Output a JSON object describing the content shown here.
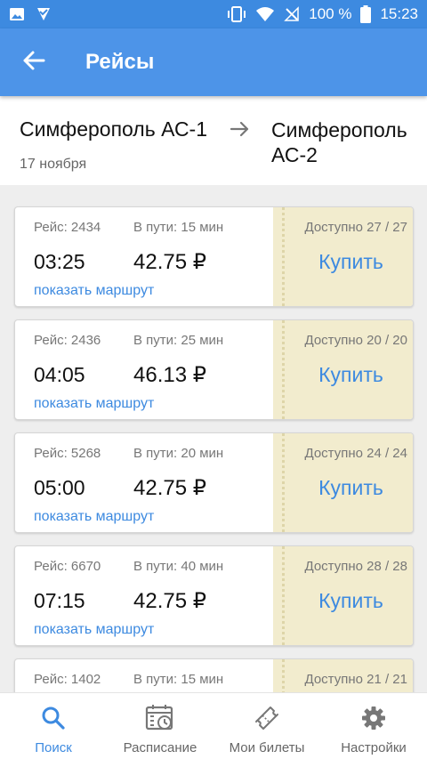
{
  "status_bar": {
    "battery": "100 %",
    "time": "15:23",
    "icons_left": [
      "image-icon",
      "notification-check-icon"
    ],
    "icons_right": [
      "vibrate-icon",
      "wifi-icon",
      "no-signal-icon",
      "battery-icon"
    ]
  },
  "app_bar": {
    "title": "Рейсы",
    "back_icon": "arrow-back-icon"
  },
  "route": {
    "from": "Симферополь АС-1",
    "to": "Симферополь АС-2",
    "date": "17 ноября"
  },
  "trips": [
    {
      "number": "Рейс: 2434",
      "duration": "В пути: 15 мин",
      "time": "03:25",
      "price": "42.75 ₽",
      "route_link": "показать маршрут",
      "availability": "Доступно 27 / 27",
      "buy_label": "Купить"
    },
    {
      "number": "Рейс: 2436",
      "duration": "В пути: 25 мин",
      "time": "04:05",
      "price": "46.13 ₽",
      "route_link": "показать маршрут",
      "availability": "Доступно 20 / 20",
      "buy_label": "Купить"
    },
    {
      "number": "Рейс: 5268",
      "duration": "В пути: 20 мин",
      "time": "05:00",
      "price": "42.75 ₽",
      "route_link": "показать маршрут",
      "availability": "Доступно 24 / 24",
      "buy_label": "Купить"
    },
    {
      "number": "Рейс: 6670",
      "duration": "В пути: 40 мин",
      "time": "07:15",
      "price": "42.75 ₽",
      "route_link": "показать маршрут",
      "availability": "Доступно 28 / 28",
      "buy_label": "Купить"
    },
    {
      "number": "Рейс: 1402",
      "duration": "В пути: 15 мин",
      "time": "",
      "price": "",
      "route_link": "",
      "availability": "Доступно 21 / 21",
      "buy_label": ""
    }
  ],
  "bottom_nav": [
    {
      "label": "Поиск",
      "icon": "search-icon",
      "active": true
    },
    {
      "label": "Расписание",
      "icon": "schedule-icon",
      "active": false
    },
    {
      "label": "Мои билеты",
      "icon": "ticket-icon",
      "active": false
    },
    {
      "label": "Настройки",
      "icon": "settings-icon",
      "active": false
    }
  ],
  "colors": {
    "primary": "#4d94e8",
    "status_bar": "#3d8ae0",
    "accent_text": "#3d8ae0",
    "ticket_stub": "#f2ecce",
    "background": "#eeeeee"
  }
}
